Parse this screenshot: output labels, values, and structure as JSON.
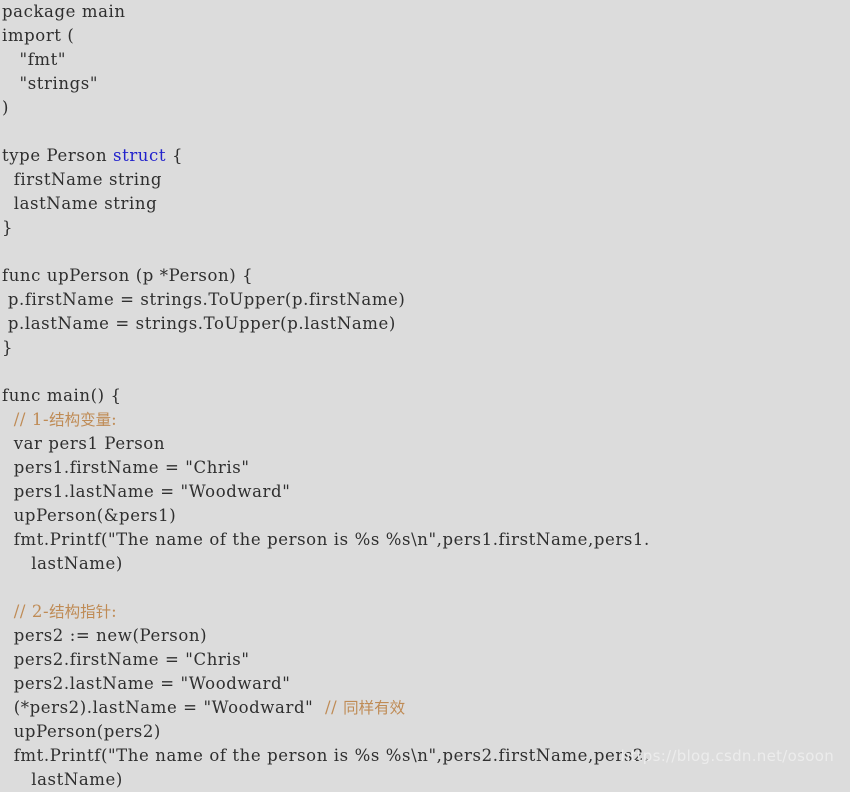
{
  "page": {
    "kind": "code-listing",
    "language": "Go",
    "background_color": "#dcdcdc",
    "text_color": "#2f2f2f",
    "keyword_color": "#2222cc",
    "comment_color": "#bf8b55",
    "watermark_color": "#ececec"
  },
  "watermark": {
    "text": "https://blog.csdn.net/osoon"
  },
  "code": {
    "lines": [
      {
        "id": "l01",
        "text": "package main"
      },
      {
        "id": "l02",
        "text": "import ("
      },
      {
        "id": "l03",
        "text": "   \"fmt\""
      },
      {
        "id": "l04",
        "text": "   \"strings\""
      },
      {
        "id": "l05",
        "text": ")"
      },
      {
        "id": "l06",
        "text": ""
      },
      {
        "id": "l07",
        "pre": "type Person ",
        "kw": "struct",
        "post": " {"
      },
      {
        "id": "l08",
        "text": "  firstName string"
      },
      {
        "id": "l09",
        "text": "  lastName string"
      },
      {
        "id": "l10",
        "text": "}"
      },
      {
        "id": "l11",
        "text": ""
      },
      {
        "id": "l12",
        "text": "func upPerson (p *Person) {"
      },
      {
        "id": "l13",
        "text": " p.firstName = strings.ToUpper(p.firstName)"
      },
      {
        "id": "l14",
        "text": " p.lastName = strings.ToUpper(p.lastName)"
      },
      {
        "id": "l15",
        "text": "}"
      },
      {
        "id": "l16",
        "text": ""
      },
      {
        "id": "l17",
        "text": "func main() {"
      },
      {
        "id": "l18",
        "comment": "  // 1-结构变量:"
      },
      {
        "id": "l19",
        "text": "  var pers1 Person"
      },
      {
        "id": "l20",
        "text": "  pers1.firstName = \"Chris\""
      },
      {
        "id": "l21",
        "text": "  pers1.lastName = \"Woodward\""
      },
      {
        "id": "l22",
        "text": "  upPerson(&pers1)"
      },
      {
        "id": "l23",
        "text": "  fmt.Printf(\"The name of the person is %s %s\\n\",pers1.firstName,pers1."
      },
      {
        "id": "l24",
        "text": "     lastName)"
      },
      {
        "id": "l25",
        "text": ""
      },
      {
        "id": "l26",
        "comment": "  // 2-结构指针:"
      },
      {
        "id": "l27",
        "text": "  pers2 := new(Person)"
      },
      {
        "id": "l28",
        "text": "  pers2.firstName = \"Chris\""
      },
      {
        "id": "l29",
        "text": "  pers2.lastName = \"Woodward\""
      },
      {
        "id": "l30",
        "pre": "  (*pers2).lastName = \"Woodward\"  ",
        "cmt": "// 同样有效"
      },
      {
        "id": "l31",
        "text": "  upPerson(pers2)"
      },
      {
        "id": "l32",
        "text": "  fmt.Printf(\"The name of the person is %s %s\\n\",pers2.firstName,pers2."
      },
      {
        "id": "l33",
        "text": "     lastName)"
      }
    ]
  }
}
